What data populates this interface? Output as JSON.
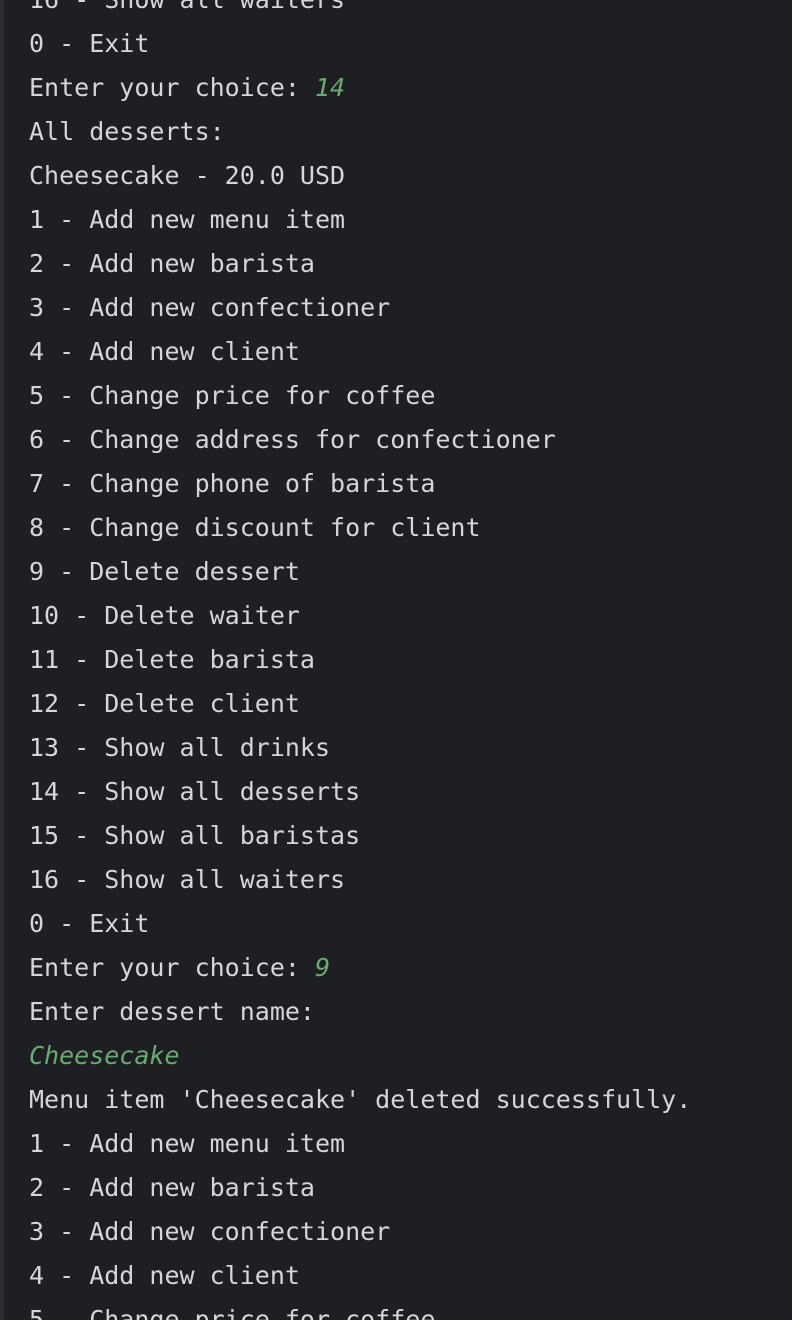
{
  "console": {
    "lines": [
      {
        "text": "16 - Show all waiters"
      },
      {
        "text": "0 - Exit"
      },
      {
        "text": "Enter your choice: ",
        "input": "14"
      },
      {
        "text": "All desserts:"
      },
      {
        "text": "Cheesecake - 20.0 USD"
      },
      {
        "text": "1 - Add new menu item"
      },
      {
        "text": "2 - Add new barista"
      },
      {
        "text": "3 - Add new confectioner"
      },
      {
        "text": "4 - Add new client"
      },
      {
        "text": "5 - Change price for coffee"
      },
      {
        "text": "6 - Change address for confectioner"
      },
      {
        "text": "7 - Change phone of barista"
      },
      {
        "text": "8 - Change discount for client"
      },
      {
        "text": "9 - Delete dessert"
      },
      {
        "text": "10 - Delete waiter"
      },
      {
        "text": "11 - Delete barista"
      },
      {
        "text": "12 - Delete client"
      },
      {
        "text": "13 - Show all drinks"
      },
      {
        "text": "14 - Show all desserts"
      },
      {
        "text": "15 - Show all baristas"
      },
      {
        "text": "16 - Show all waiters"
      },
      {
        "text": "0 - Exit"
      },
      {
        "text": "Enter your choice: ",
        "input": "9"
      },
      {
        "text": "Enter dessert name:"
      },
      {
        "text": "",
        "input": "Cheesecake"
      },
      {
        "text": "Menu item 'Cheesecake' deleted successfully."
      },
      {
        "text": "1 - Add new menu item"
      },
      {
        "text": "2 - Add new barista"
      },
      {
        "text": "3 - Add new confectioner"
      },
      {
        "text": "4 - Add new client"
      },
      {
        "text": "5 - Change price for coffee"
      }
    ]
  },
  "colors": {
    "background": "#1e1f22",
    "output_text": "#d4d6db",
    "user_input": "#6aab73"
  }
}
